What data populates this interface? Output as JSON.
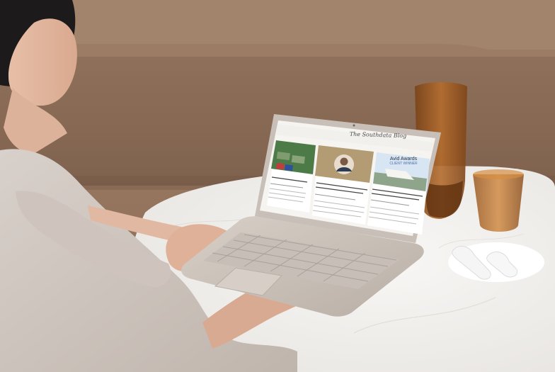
{
  "scene": {
    "type": "photo",
    "description": ""
  },
  "screen": {
    "blog_title": "The Southdata Blog",
    "cards": [
      {
        "image": "flags-and-graves",
        "title": "",
        "date": "",
        "excerpt": ""
      },
      {
        "image": "portrait",
        "title": "",
        "date": "",
        "excerpt": ""
      },
      {
        "image": "award-banner",
        "award_line1": "Avid Awards",
        "award_line2": "CLIENT WINNER",
        "title": "",
        "date": "",
        "excerpt": ""
      }
    ]
  },
  "colors": {
    "wall": "#9b7b65",
    "sofa": "#8b6b55",
    "table": "#f3f1ef",
    "laptop": "#c8bfb6",
    "screen_bg": "#f6f4f1",
    "vase": "#9b5a22"
  }
}
